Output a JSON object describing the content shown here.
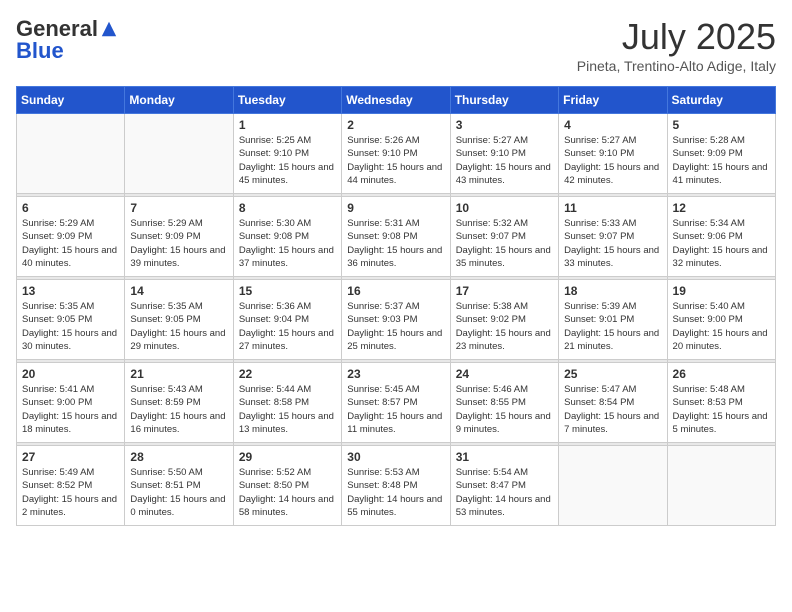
{
  "header": {
    "logo_general": "General",
    "logo_blue": "Blue",
    "month_year": "July 2025",
    "location": "Pineta, Trentino-Alto Adige, Italy"
  },
  "days_of_week": [
    "Sunday",
    "Monday",
    "Tuesday",
    "Wednesday",
    "Thursday",
    "Friday",
    "Saturday"
  ],
  "weeks": [
    [
      {
        "day": "",
        "info": ""
      },
      {
        "day": "",
        "info": ""
      },
      {
        "day": "1",
        "info": "Sunrise: 5:25 AM\nSunset: 9:10 PM\nDaylight: 15 hours and 45 minutes."
      },
      {
        "day": "2",
        "info": "Sunrise: 5:26 AM\nSunset: 9:10 PM\nDaylight: 15 hours and 44 minutes."
      },
      {
        "day": "3",
        "info": "Sunrise: 5:27 AM\nSunset: 9:10 PM\nDaylight: 15 hours and 43 minutes."
      },
      {
        "day": "4",
        "info": "Sunrise: 5:27 AM\nSunset: 9:10 PM\nDaylight: 15 hours and 42 minutes."
      },
      {
        "day": "5",
        "info": "Sunrise: 5:28 AM\nSunset: 9:09 PM\nDaylight: 15 hours and 41 minutes."
      }
    ],
    [
      {
        "day": "6",
        "info": "Sunrise: 5:29 AM\nSunset: 9:09 PM\nDaylight: 15 hours and 40 minutes."
      },
      {
        "day": "7",
        "info": "Sunrise: 5:29 AM\nSunset: 9:09 PM\nDaylight: 15 hours and 39 minutes."
      },
      {
        "day": "8",
        "info": "Sunrise: 5:30 AM\nSunset: 9:08 PM\nDaylight: 15 hours and 37 minutes."
      },
      {
        "day": "9",
        "info": "Sunrise: 5:31 AM\nSunset: 9:08 PM\nDaylight: 15 hours and 36 minutes."
      },
      {
        "day": "10",
        "info": "Sunrise: 5:32 AM\nSunset: 9:07 PM\nDaylight: 15 hours and 35 minutes."
      },
      {
        "day": "11",
        "info": "Sunrise: 5:33 AM\nSunset: 9:07 PM\nDaylight: 15 hours and 33 minutes."
      },
      {
        "day": "12",
        "info": "Sunrise: 5:34 AM\nSunset: 9:06 PM\nDaylight: 15 hours and 32 minutes."
      }
    ],
    [
      {
        "day": "13",
        "info": "Sunrise: 5:35 AM\nSunset: 9:05 PM\nDaylight: 15 hours and 30 minutes."
      },
      {
        "day": "14",
        "info": "Sunrise: 5:35 AM\nSunset: 9:05 PM\nDaylight: 15 hours and 29 minutes."
      },
      {
        "day": "15",
        "info": "Sunrise: 5:36 AM\nSunset: 9:04 PM\nDaylight: 15 hours and 27 minutes."
      },
      {
        "day": "16",
        "info": "Sunrise: 5:37 AM\nSunset: 9:03 PM\nDaylight: 15 hours and 25 minutes."
      },
      {
        "day": "17",
        "info": "Sunrise: 5:38 AM\nSunset: 9:02 PM\nDaylight: 15 hours and 23 minutes."
      },
      {
        "day": "18",
        "info": "Sunrise: 5:39 AM\nSunset: 9:01 PM\nDaylight: 15 hours and 21 minutes."
      },
      {
        "day": "19",
        "info": "Sunrise: 5:40 AM\nSunset: 9:00 PM\nDaylight: 15 hours and 20 minutes."
      }
    ],
    [
      {
        "day": "20",
        "info": "Sunrise: 5:41 AM\nSunset: 9:00 PM\nDaylight: 15 hours and 18 minutes."
      },
      {
        "day": "21",
        "info": "Sunrise: 5:43 AM\nSunset: 8:59 PM\nDaylight: 15 hours and 16 minutes."
      },
      {
        "day": "22",
        "info": "Sunrise: 5:44 AM\nSunset: 8:58 PM\nDaylight: 15 hours and 13 minutes."
      },
      {
        "day": "23",
        "info": "Sunrise: 5:45 AM\nSunset: 8:57 PM\nDaylight: 15 hours and 11 minutes."
      },
      {
        "day": "24",
        "info": "Sunrise: 5:46 AM\nSunset: 8:55 PM\nDaylight: 15 hours and 9 minutes."
      },
      {
        "day": "25",
        "info": "Sunrise: 5:47 AM\nSunset: 8:54 PM\nDaylight: 15 hours and 7 minutes."
      },
      {
        "day": "26",
        "info": "Sunrise: 5:48 AM\nSunset: 8:53 PM\nDaylight: 15 hours and 5 minutes."
      }
    ],
    [
      {
        "day": "27",
        "info": "Sunrise: 5:49 AM\nSunset: 8:52 PM\nDaylight: 15 hours and 2 minutes."
      },
      {
        "day": "28",
        "info": "Sunrise: 5:50 AM\nSunset: 8:51 PM\nDaylight: 15 hours and 0 minutes."
      },
      {
        "day": "29",
        "info": "Sunrise: 5:52 AM\nSunset: 8:50 PM\nDaylight: 14 hours and 58 minutes."
      },
      {
        "day": "30",
        "info": "Sunrise: 5:53 AM\nSunset: 8:48 PM\nDaylight: 14 hours and 55 minutes."
      },
      {
        "day": "31",
        "info": "Sunrise: 5:54 AM\nSunset: 8:47 PM\nDaylight: 14 hours and 53 minutes."
      },
      {
        "day": "",
        "info": ""
      },
      {
        "day": "",
        "info": ""
      }
    ]
  ]
}
